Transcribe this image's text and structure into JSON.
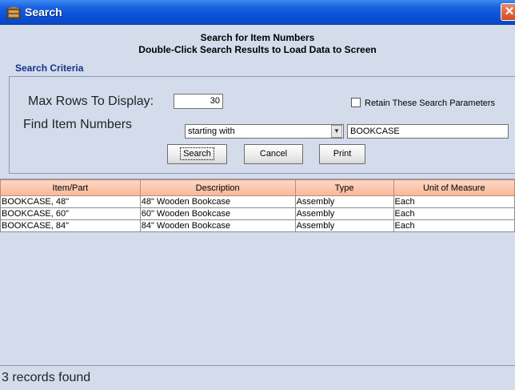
{
  "window": {
    "title": "Search",
    "icon": "bookcase-icon"
  },
  "header": {
    "line1": "Search for Item Numbers",
    "line2": "Double-Click Search Results to Load Data to Screen"
  },
  "criteria": {
    "section_label": "Search Criteria",
    "max_rows_label": "Max Rows To Display:",
    "max_rows_value": "30",
    "retain_label": "Retain These Search Parameters",
    "retain_checked": false,
    "find_label": "Find Item Numbers",
    "match_mode": "starting with",
    "search_text": "BOOKCASE"
  },
  "buttons": {
    "search": "Search",
    "cancel": "Cancel",
    "print": "Print"
  },
  "table": {
    "columns": [
      "Item/Part",
      "Description",
      "Type",
      "Unit of Measure"
    ],
    "rows": [
      [
        "BOOKCASE, 48\"",
        "48\" Wooden Bookcase",
        "Assembly",
        "Each"
      ],
      [
        "BOOKCASE, 60\"",
        "60\" Wooden Bookcase",
        "Assembly",
        "Each"
      ],
      [
        "BOOKCASE, 84\"",
        "84\" Wooden Bookcase",
        "Assembly",
        "Each"
      ]
    ]
  },
  "status": "3 records found",
  "colors": {
    "titlebar": "#0a4fd8",
    "background": "#d4dcec",
    "header_accent": "#f6b89a",
    "label_blue": "#13338a"
  }
}
